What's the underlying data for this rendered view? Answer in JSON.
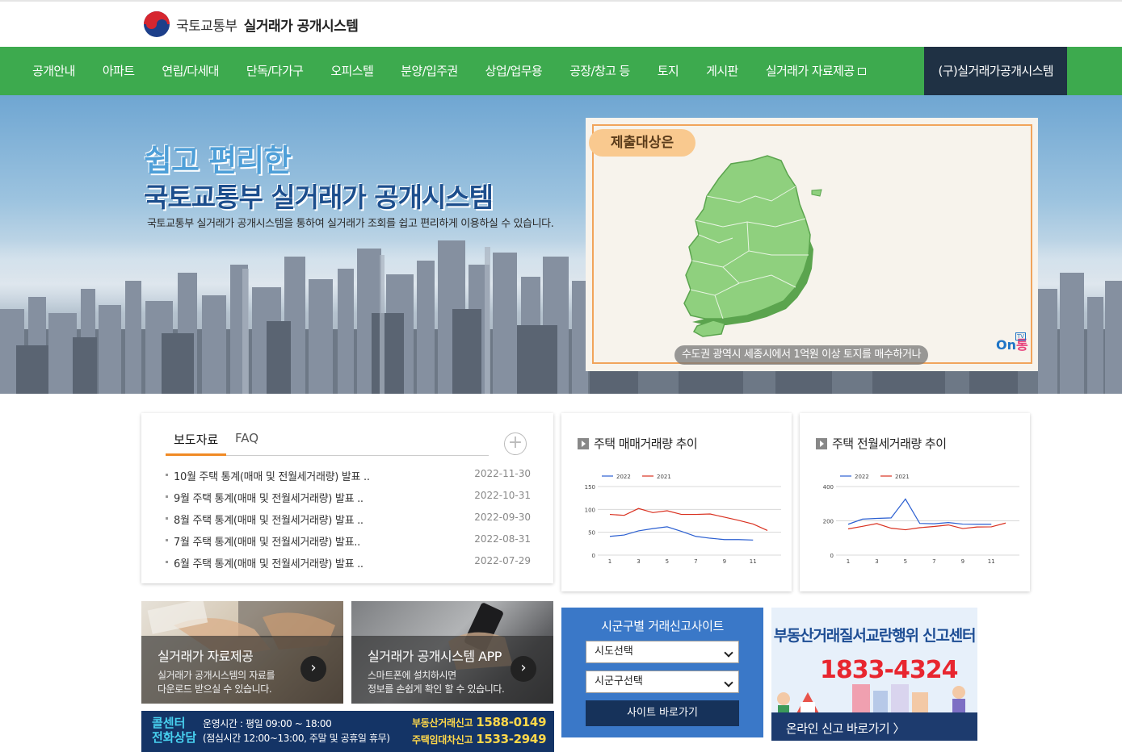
{
  "header": {
    "ministry": "국토교통부",
    "system_name": "실거래가 공개시스템"
  },
  "nav": {
    "items": [
      {
        "label": "공개안내"
      },
      {
        "label": "아파트"
      },
      {
        "label": "연립/다세대"
      },
      {
        "label": "단독/다가구"
      },
      {
        "label": "오피스텔"
      },
      {
        "label": "분양/입주권"
      },
      {
        "label": "상업/업무용"
      },
      {
        "label": "공장/창고 등"
      },
      {
        "label": "토지"
      },
      {
        "label": "게시판"
      },
      {
        "label": "실거래가 자료제공"
      }
    ],
    "legacy_label": "(구)실거래가공개시스템",
    "accent": "#3daa4e",
    "legacy_bg": "#1f3144"
  },
  "hero": {
    "title1": "쉽고 편리한",
    "title2": "국토교통부 실거래가 공개시스템",
    "subtitle": "국토교통부 실거래가 공개시스템을 통하여 실거래가 조회를 쉽고 편리하게 이용하실 수 있습니다.",
    "video": {
      "tag": "제출대상은",
      "caption": "수도권 광역시 세종시에서 1억원 이상 토지를 매수하거나",
      "brand_on": "On",
      "brand_tong": "통",
      "brand_tv": "TV"
    }
  },
  "news": {
    "tabs": [
      {
        "label": "보도자료"
      },
      {
        "label": "FAQ"
      }
    ],
    "more": "+",
    "items": [
      {
        "title": "10월 주택 통계(매매 및 전월세거래량) 발표 ..",
        "date": "2022-11-30"
      },
      {
        "title": "9월 주택 통계(매매 및 전월세거래량) 발표 ..",
        "date": "2022-10-31"
      },
      {
        "title": "8월 주택 통계(매매 및 전월세거래량) 발표 ..",
        "date": "2022-09-30"
      },
      {
        "title": "7월 주택 통계(매매 및 전월세거래량) 발표..",
        "date": "2022-08-31"
      },
      {
        "title": "6월 주택 통계(매매 및 전월세거래량) 발표 ..",
        "date": "2022-07-29"
      }
    ]
  },
  "chart_data": [
    {
      "type": "line",
      "title": "주택 매매거래량 추이",
      "x": [
        1,
        2,
        3,
        4,
        5,
        6,
        7,
        8,
        9,
        10,
        11,
        12
      ],
      "xticks": [
        "1",
        "3",
        "5",
        "7",
        "9",
        "11"
      ],
      "ylim": [
        0,
        150
      ],
      "yticks": [
        "0",
        "50",
        "100",
        "150"
      ],
      "grid": true,
      "legend": "top-left",
      "series": [
        {
          "name": "2022",
          "color": "#2b5fd1",
          "values": [
            41,
            44,
            53,
            58,
            62,
            52,
            41,
            37,
            34,
            34,
            33
          ]
        },
        {
          "name": "2021",
          "color": "#d9301f",
          "values": [
            89,
            87,
            102,
            93,
            97,
            89,
            89,
            90,
            83,
            76,
            68,
            54
          ]
        }
      ]
    },
    {
      "type": "line",
      "title": "주택 전월세거래량 추이",
      "x": [
        1,
        2,
        3,
        4,
        5,
        6,
        7,
        8,
        9,
        10,
        11,
        12
      ],
      "xticks": [
        "1",
        "3",
        "5",
        "7",
        "9",
        "11"
      ],
      "ylim": [
        0,
        400
      ],
      "yticks": [
        "0",
        "200",
        "400"
      ],
      "grid": true,
      "legend": "top-left",
      "series": [
        {
          "name": "2022",
          "color": "#2b5fd1",
          "values": [
            180,
            210,
            214,
            217,
            327,
            185,
            183,
            190,
            181,
            180,
            180
          ]
        },
        {
          "name": "2021",
          "color": "#d9301f",
          "values": [
            153,
            168,
            184,
            157,
            148,
            160,
            167,
            176,
            155,
            164,
            165,
            187
          ]
        }
      ]
    }
  ],
  "promos": [
    {
      "title": "실거래가 자료제공",
      "desc": "실거래가 공개시스템의 자료를\n다운로드 받으실 수 있습니다.",
      "go": "›"
    },
    {
      "title": "실거래가 공개시스템 APP",
      "desc": "스마트폰에 설치하시면\n정보를 손쉽게 확인 할 수 있습니다.",
      "go": "›"
    }
  ],
  "callcenter": {
    "label1": "콜센터",
    "label2": "전화상담",
    "hours": "운영시간 : 평일 09:00 ~ 18:00",
    "lunch": "(점심시간 12:00~13:00, 주말 및 공휴일 휴무)",
    "phone1_label": "부동산거래신고",
    "phone1": "1588-0149",
    "phone2_label": "주택임대차신고",
    "phone2": "1533-2949"
  },
  "sitebox": {
    "title": "시군구별 거래신고사이트",
    "sido": "시도선택",
    "sigungu": "시군구선택",
    "button": "사이트 바로가기"
  },
  "report": {
    "title": "부동산거래질서교란행위 신고센터",
    "phone": "1833-4324",
    "link": "온라인 신고 바로가기 〉"
  }
}
